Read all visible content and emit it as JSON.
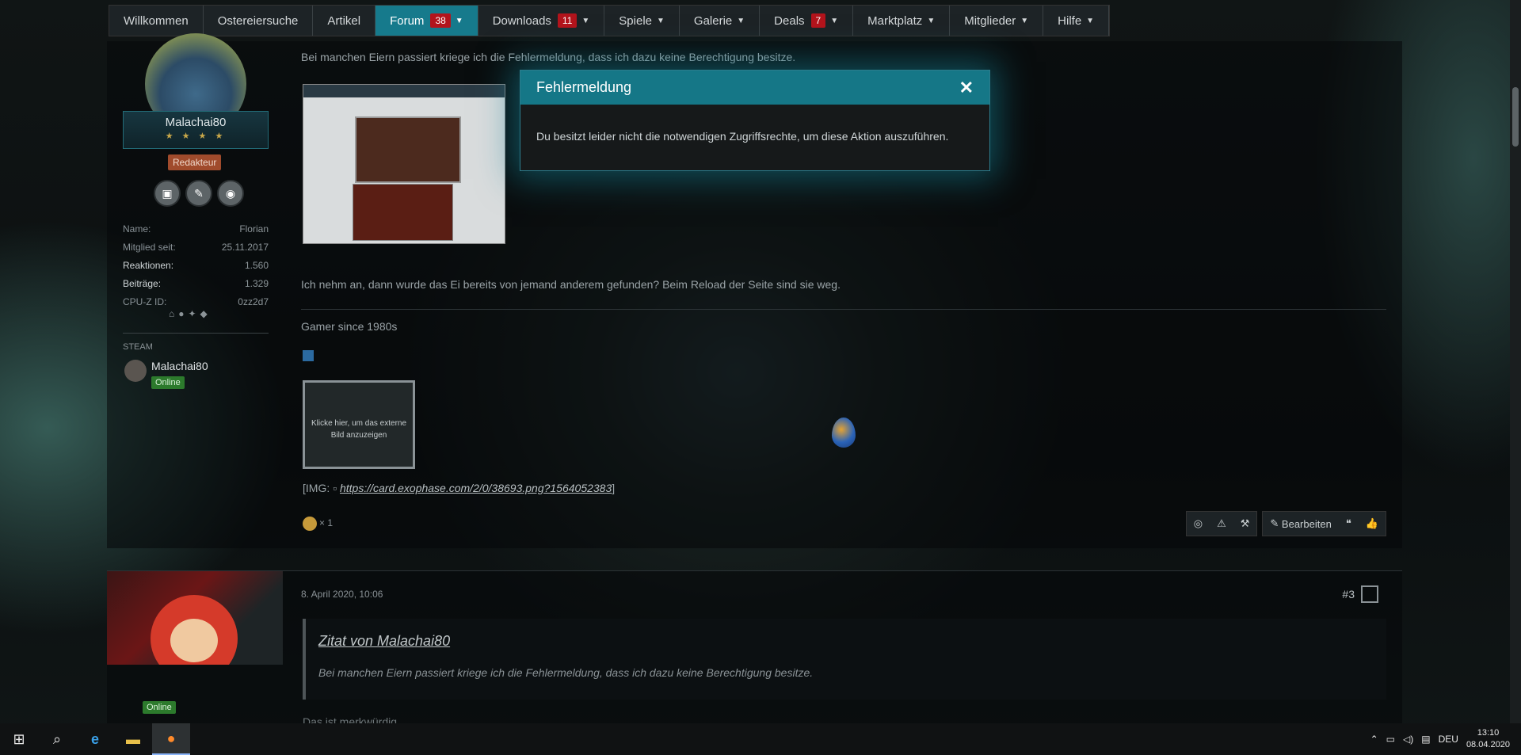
{
  "nav": {
    "items": [
      {
        "label": "Willkommen",
        "badge": "",
        "chevron": false
      },
      {
        "label": "Ostereiersuche",
        "badge": "",
        "chevron": false
      },
      {
        "label": "Artikel",
        "badge": "",
        "chevron": false
      },
      {
        "label": "Forum",
        "badge": "38",
        "chevron": true,
        "active": true
      },
      {
        "label": "Downloads",
        "badge": "11",
        "chevron": true
      },
      {
        "label": "Spiele",
        "badge": "",
        "chevron": true
      },
      {
        "label": "Galerie",
        "badge": "",
        "chevron": true
      },
      {
        "label": "Deals",
        "badge": "7",
        "chevron": true
      },
      {
        "label": "Marktplatz",
        "badge": "",
        "chevron": true
      },
      {
        "label": "Mitglieder",
        "badge": "",
        "chevron": true
      },
      {
        "label": "Hilfe",
        "badge": "",
        "chevron": true
      }
    ]
  },
  "post1": {
    "author": {
      "username": "Malachai80",
      "stars": "★ ★ ★ ★",
      "role": "Redakteur",
      "info": [
        {
          "key": "Name:",
          "value": "Florian",
          "bold": false
        },
        {
          "key": "Mitglied seit:",
          "value": "25.11.2017",
          "bold": false
        },
        {
          "key": "Reaktionen:",
          "value": "1.560",
          "bold": true
        },
        {
          "key": "Beiträge:",
          "value": "1.329",
          "bold": true
        },
        {
          "key": "CPU-Z ID:",
          "value": "0zz2d7",
          "bold": false
        }
      ],
      "steam_label": "STEAM",
      "steam_name": "Malachai80",
      "steam_status": "Online"
    },
    "text1": "Bei manchen Eiern passiert kriege ich die Fehlermeldung, dass ich dazu keine Berechtigung besitze.",
    "text2": "Ich nehm an, dann wurde das Ei bereits von jemand anderem gefunden? Beim Reload der Seite sind sie weg.",
    "signature": "Gamer since 1980s",
    "external_image_label": "Klicke hier, um das externe Bild anzuzeigen",
    "img_prefix": "[IMG:",
    "img_link": "https://card.exophase.com/2/0/38693.png?1564052383",
    "img_suffix": "]",
    "reaction_count": "× 1",
    "actions": {
      "edit": "Bearbeiten"
    }
  },
  "post2": {
    "status": "Online",
    "date": "8. April 2020, 10:06",
    "number": "#3",
    "quote_author": "Zitat von Malachai80",
    "quote_text": "Bei manchen Eiern passiert kriege ich die Fehlermeldung, dass ich dazu keine Berechtigung besitze.",
    "text": "Das ist merkwürdig."
  },
  "modal": {
    "title": "Fehlermeldung",
    "message": "Du besitzt leider nicht die notwendigen Zugriffsrechte, um diese Aktion auszuführen."
  },
  "taskbar": {
    "lang": "DEU",
    "time": "13:10",
    "date": "08.04.2020"
  },
  "colors": {
    "accent": "#167a8c",
    "badge": "#b3141c",
    "online": "#2c7a2c",
    "role": "#a04b2c"
  }
}
